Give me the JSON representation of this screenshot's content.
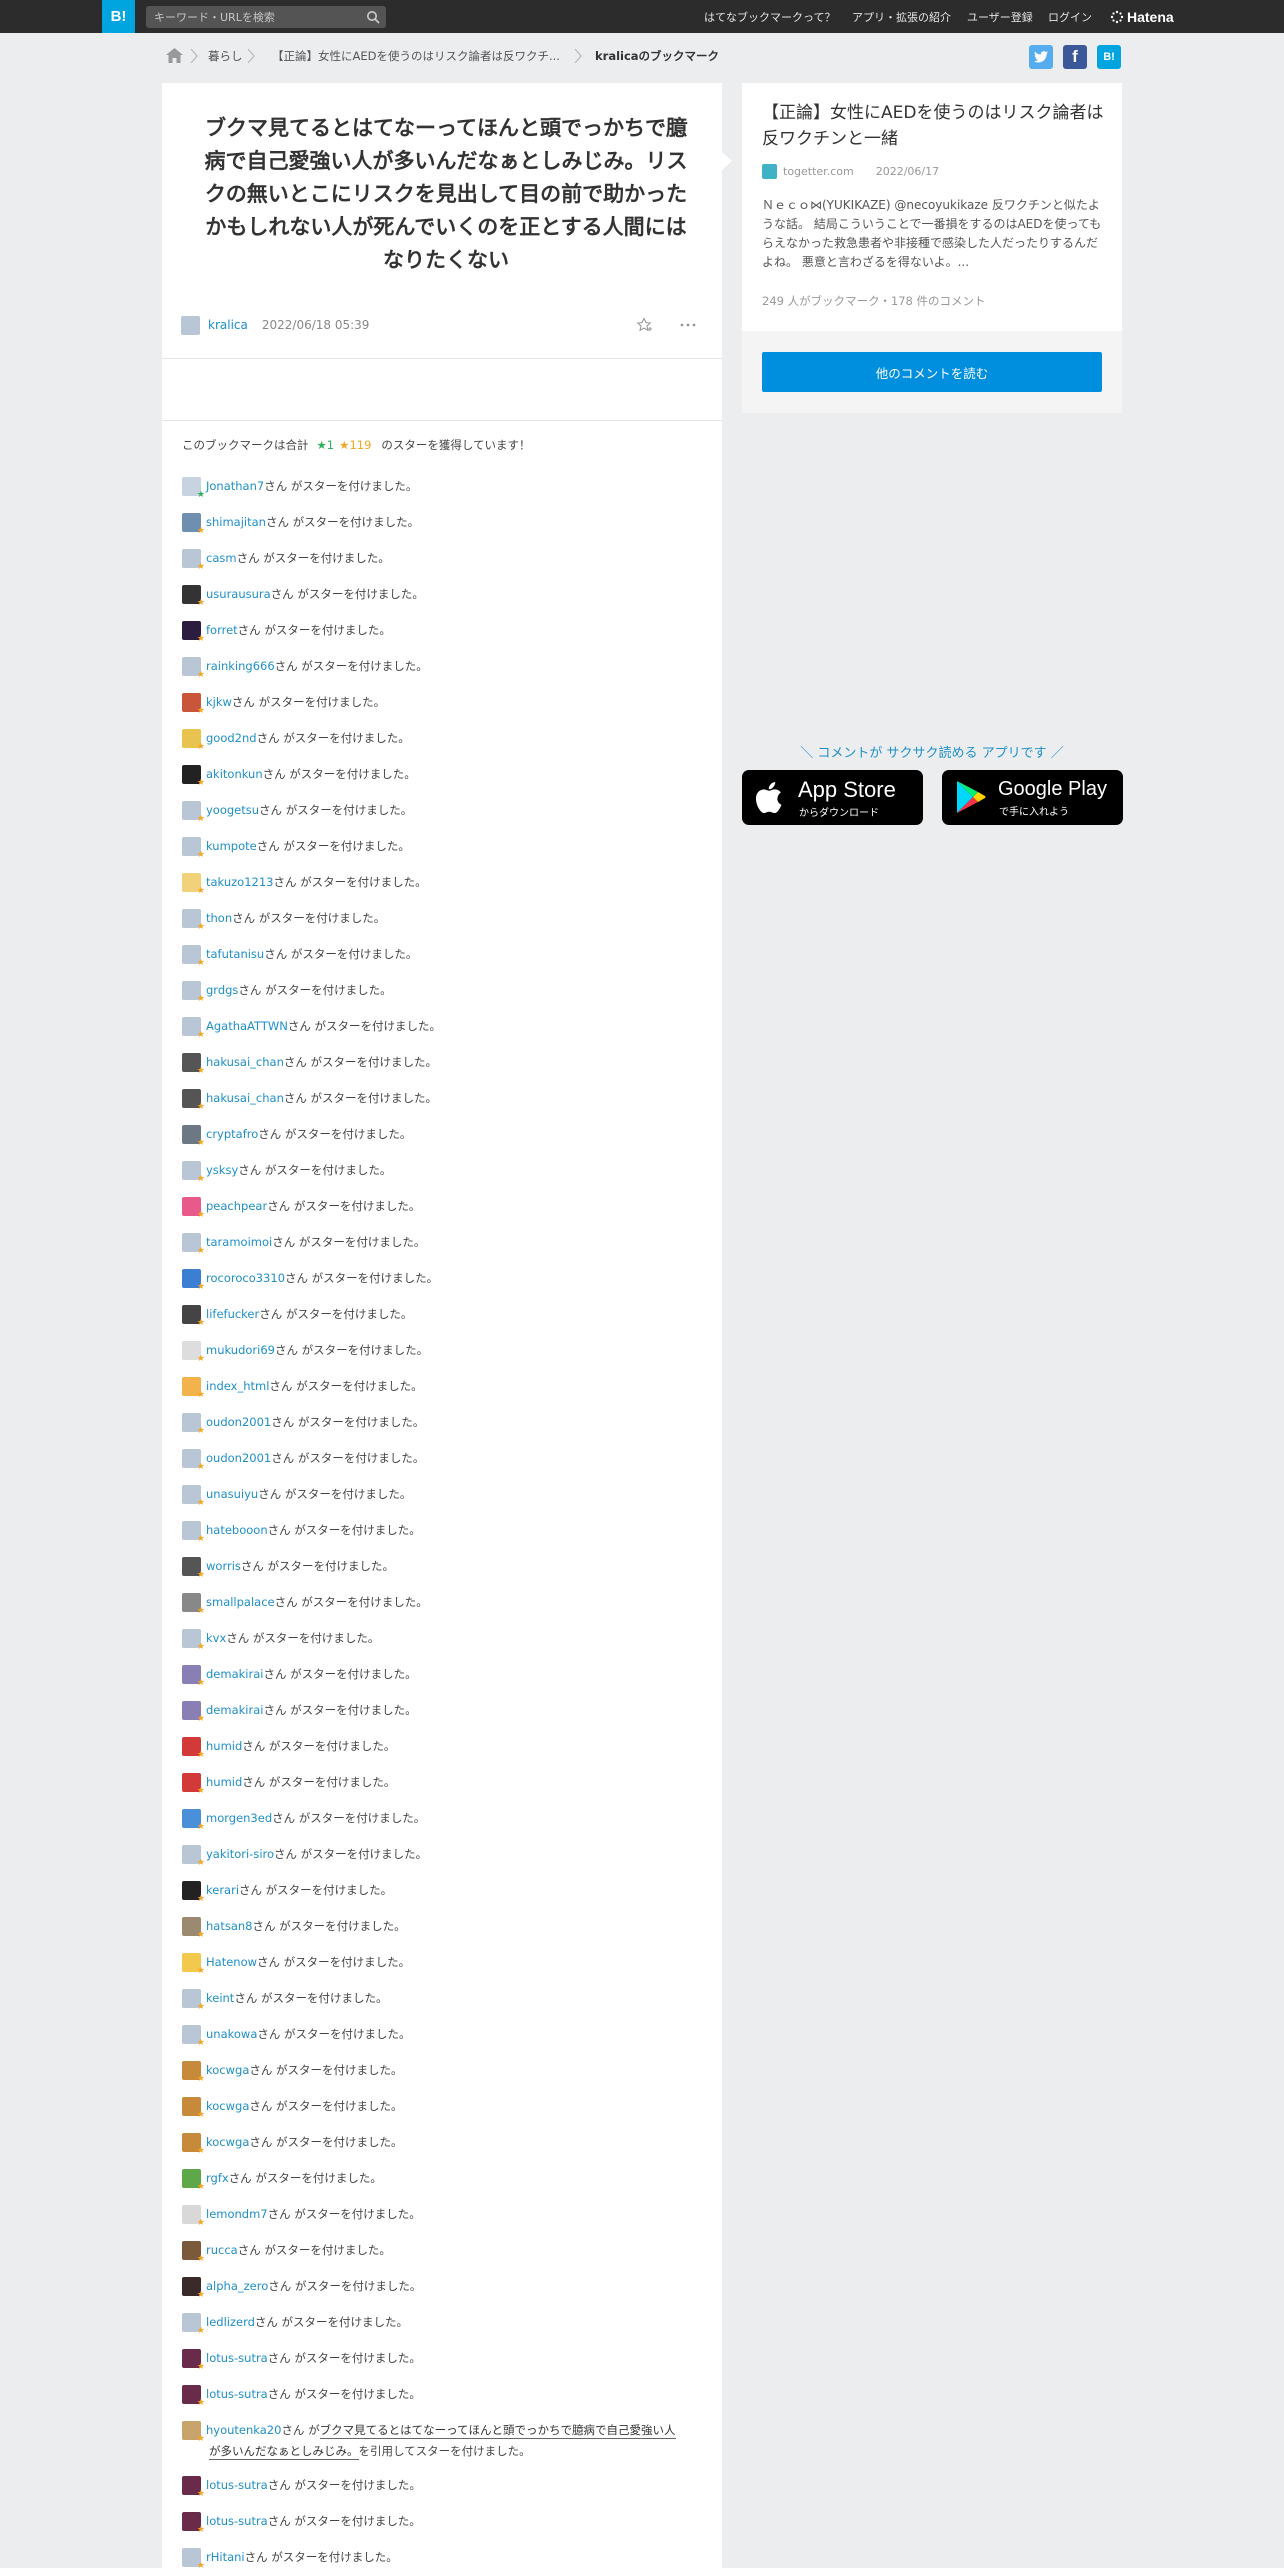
{
  "topbar": {
    "logo": "B!",
    "search_placeholder": "キーワード・URLを検索",
    "nav": [
      "はてなブックマークって？",
      "アプリ・拡張の紹介",
      "ユーザー登録",
      "ログイン"
    ],
    "brand": "Hatena"
  },
  "breadcrumb": {
    "items": [
      "暮らし",
      "【正論】女性にAEDを使うのはリスク論者は反ワクチ...",
      "kralicaのブックマーク"
    ]
  },
  "share": {
    "twitter": "t",
    "facebook": "f",
    "hatena": "B!"
  },
  "colors": {
    "accent": "#008fde",
    "link": "#1f8fc9",
    "star_yellow": "#f5a623",
    "star_green": "#2bb25c"
  },
  "bookmark": {
    "comment": "ブクマ見てるとはてなーってほんと頭でっかちで臆病で自己愛強い人が多いんだなぁとしみじみ。リスクの無いとこにリスクを見出して目の前で助かったかもしれない人が死んでいくのを正とする人間にはなりたくない",
    "user": "kralica",
    "date": "2022/06/18 05:39"
  },
  "star_summary": {
    "prefix": "このブックマークは合計",
    "green": "★1",
    "yellow": "★119",
    "suffix": "のスターを獲得しています！"
  },
  "star_suffix": "さん がスターを付けました。",
  "star_users": [
    "Jonathan7",
    "shimajitan",
    "casm",
    "usurausura",
    "forret",
    "rainking666",
    "kjkw",
    "good2nd",
    "akitonkun",
    "yoogetsu",
    "kumpote",
    "takuzo1213",
    "thon",
    "tafutanisu",
    "grdgs",
    "AgathaATTWN",
    "hakusai_chan",
    "hakusai_chan",
    "cryptafro",
    "ysksy",
    "peachpear",
    "taramoimoi",
    "rocoroco3310",
    "lifefucker",
    "mukudori69",
    "index_html",
    "oudon2001",
    "oudon2001",
    "unasuiyu",
    "hatebooon",
    "worris",
    "smallpalace",
    "kvx",
    "demakirai",
    "demakirai",
    "humid",
    "humid",
    "morgen3ed",
    "yakitori-siro",
    "kerari",
    "hatsan8",
    "Hatenow",
    "keint",
    "unakowa",
    "kocwga",
    "kocwga",
    "kocwga",
    "rgfx",
    "lemondm7",
    "rucca",
    "alpha_zero",
    "ledlizerd",
    "lotus-sutra",
    "lotus-sutra"
  ],
  "quote_row": {
    "user": "hyoutenka20",
    "prefix": "さん が",
    "line1": "ブクマ見てるとはてなーってほんと頭でっかちで臆病で自己愛強い人",
    "line2": "が多いんだなぁとしみじみ。",
    "suffix": "を引用してスターを付けました。"
  },
  "star_users_after": [
    "lotus-sutra",
    "lotus-sutra",
    "rHitani"
  ],
  "entry": {
    "title": "【正論】女性にAEDを使うのはリスク論者は反ワクチンと一緒",
    "site": "togetter.com",
    "date": "2022/06/17",
    "excerpt": "Ｎｅｃｏ⋈(YUKIKAZE) @necoyukikaze 反ワクチンと似たような話。 結局こういうことで一番損をするのはAEDを使ってもらえなかった救急患者や非接種で感染した人だったりするんだよね。 悪意と言わざるを得ないよ。...",
    "count": "249 人がブックマーク・178 件のコメント",
    "more_button": "他のコメントを読む"
  },
  "apps": {
    "tagline": "＼ コメントが サクサク読める アプリです ／",
    "appstore_small": "からダウンロード",
    "appstore_big": "App Store",
    "play_big": "Google Play",
    "play_small": "で手に入れよう"
  }
}
